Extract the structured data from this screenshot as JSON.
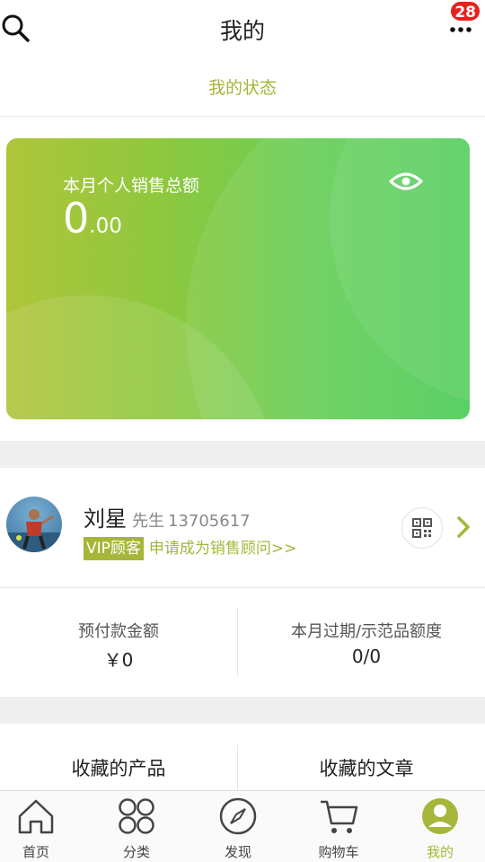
{
  "header": {
    "title": "我的",
    "notification_count": "28"
  },
  "status_tab": {
    "label": "我的状态"
  },
  "sales_card": {
    "label": "本月个人销售总额",
    "amount_integer": "0",
    "amount_decimal": ".00",
    "eye_icon": "eye-icon"
  },
  "profile": {
    "name": "刘星",
    "honorific": "先生",
    "phone": "13705617",
    "vip_label": "VIP顾客",
    "apply_link": "申请成为销售顾问>>",
    "qr_icon": "qr-code-icon"
  },
  "stats": [
    {
      "label": "预付款金额",
      "value": "￥0"
    },
    {
      "label": "本月过期/示范品额度",
      "value": "0/0"
    }
  ],
  "favorites": [
    {
      "label": "收藏的产品"
    },
    {
      "label": "收藏的文章"
    }
  ],
  "tabbar": {
    "active_color": "#a5b63a",
    "items": [
      {
        "label": "首页",
        "icon": "home-icon"
      },
      {
        "label": "分类",
        "icon": "category-icon"
      },
      {
        "label": "发现",
        "icon": "compass-icon"
      },
      {
        "label": "购物车",
        "icon": "cart-icon"
      },
      {
        "label": "我的",
        "icon": "profile-icon"
      }
    ]
  },
  "colors": {
    "accent": "#a5b63a",
    "badge": "#e8201f",
    "card_gradient_start": "#b0c53a",
    "card_gradient_end": "#4dcc5a"
  }
}
